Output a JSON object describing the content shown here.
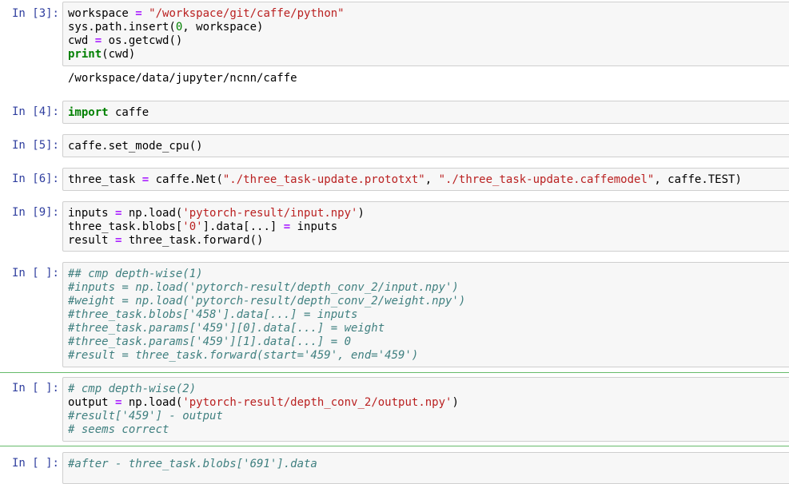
{
  "cells": [
    {
      "prompt": "In [3]:",
      "lines": [
        [
          [
            "t",
            "workspace "
          ],
          [
            "o",
            "="
          ],
          [
            "t",
            " "
          ],
          [
            "s",
            "\"/workspace/git/caffe/python\""
          ]
        ],
        [
          [
            "t",
            "sys.path.insert("
          ],
          [
            "n",
            "0"
          ],
          [
            "t",
            ", workspace)"
          ]
        ],
        [
          [
            "t",
            "cwd "
          ],
          [
            "o",
            "="
          ],
          [
            "t",
            " os.getcwd()"
          ]
        ],
        [
          [
            "k",
            "print"
          ],
          [
            "t",
            "(cwd)"
          ]
        ]
      ],
      "output": "/workspace/data/jupyter/ncnn/caffe"
    },
    {
      "prompt": "In [4]:",
      "lines": [
        [
          [
            "k",
            "import"
          ],
          [
            "t",
            " caffe"
          ]
        ]
      ]
    },
    {
      "prompt": "In [5]:",
      "lines": [
        [
          [
            "t",
            "caffe.set_mode_cpu()"
          ]
        ]
      ]
    },
    {
      "prompt": "In [6]:",
      "lines": [
        [
          [
            "t",
            "three_task "
          ],
          [
            "o",
            "="
          ],
          [
            "t",
            " caffe.Net("
          ],
          [
            "s",
            "\"./three_task-update.prototxt\""
          ],
          [
            "t",
            ", "
          ],
          [
            "s",
            "\"./three_task-update.caffemodel\""
          ],
          [
            "t",
            ", caffe.TEST)"
          ]
        ]
      ]
    },
    {
      "prompt": "In [9]:",
      "lines": [
        [
          [
            "t",
            "inputs "
          ],
          [
            "o",
            "="
          ],
          [
            "t",
            " np.load("
          ],
          [
            "s",
            "'pytorch-result/input.npy'"
          ],
          [
            "t",
            ")"
          ]
        ],
        [
          [
            "t",
            "three_task.blobs["
          ],
          [
            "s",
            "'0'"
          ],
          [
            "t",
            "].data[...] "
          ],
          [
            "o",
            "="
          ],
          [
            "t",
            " inputs"
          ]
        ],
        [
          [
            "t",
            "result "
          ],
          [
            "o",
            "="
          ],
          [
            "t",
            " three_task.forward()"
          ]
        ]
      ]
    },
    {
      "prompt": "In [ ]:",
      "lines": [
        [
          [
            "c",
            "## cmp depth-wise(1)"
          ]
        ],
        [
          [
            "c",
            "#inputs = np.load('pytorch-result/depth_conv_2/input.npy')"
          ]
        ],
        [
          [
            "c",
            "#weight = np.load('pytorch-result/depth_conv_2/weight.npy')"
          ]
        ],
        [
          [
            "c",
            "#three_task.blobs['458'].data[...] = inputs"
          ]
        ],
        [
          [
            "c",
            "#three_task.params['459'][0].data[...] = weight"
          ]
        ],
        [
          [
            "c",
            "#three_task.params['459'][1].data[...] = 0"
          ]
        ],
        [
          [
            "c",
            "#result = three_task.forward(start='459', end='459')"
          ]
        ]
      ]
    },
    {
      "prompt": "In [ ]:",
      "lines": [
        [
          [
            "c",
            "# cmp depth-wise(2)"
          ]
        ],
        [
          [
            "t",
            "output "
          ],
          [
            "o",
            "="
          ],
          [
            "t",
            " np.load("
          ],
          [
            "s",
            "'pytorch-result/depth_conv_2/output.npy'"
          ],
          [
            "t",
            ")"
          ]
        ],
        [
          [
            "c",
            "#result['459'] - output"
          ]
        ],
        [
          [
            "c",
            "# seems correct"
          ]
        ]
      ]
    },
    {
      "prompt": "In [ ]:",
      "lines": [
        [
          [
            "c",
            "#after - three_task.blobs['691'].data"
          ]
        ]
      ]
    }
  ]
}
